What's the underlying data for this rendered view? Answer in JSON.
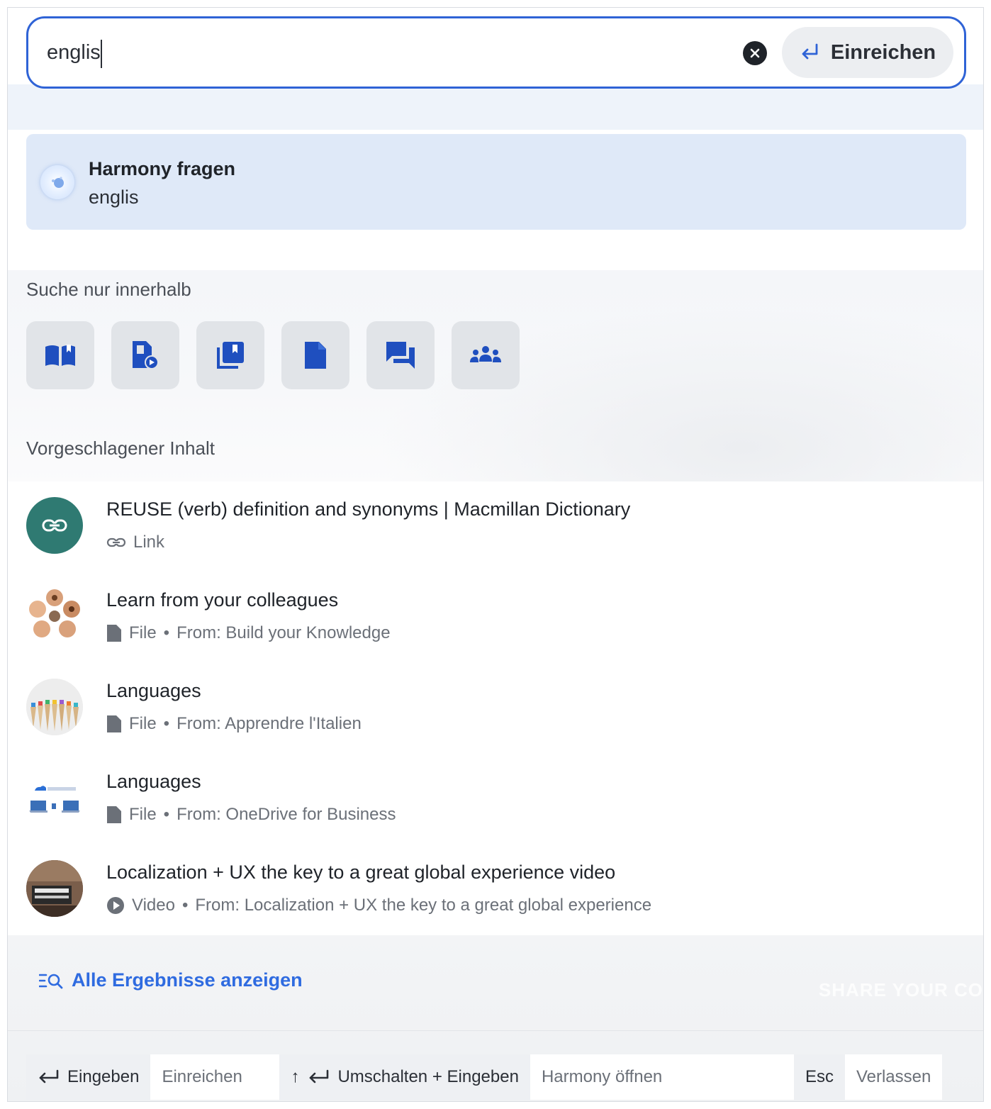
{
  "search": {
    "value": "englis",
    "clear_icon": "close-circle-icon",
    "submit_label": "Einreichen",
    "submit_icon": "enter-arrow-icon"
  },
  "harmony": {
    "title": "Harmony fragen",
    "query": "englis",
    "icon": "harmony-assistant-icon"
  },
  "scope": {
    "label": "Suche nur innerhalb",
    "buttons": [
      {
        "icon": "book-open-icon"
      },
      {
        "icon": "video-file-icon"
      },
      {
        "icon": "library-icon"
      },
      {
        "icon": "document-icon"
      },
      {
        "icon": "chat-icon"
      },
      {
        "icon": "community-icon"
      }
    ]
  },
  "suggested": {
    "label": "Vorgeschlagener Inhalt",
    "items": [
      {
        "title": "REUSE (verb) definition and synonyms | Macmillan Dictionary",
        "type": "Link",
        "source": "",
        "icon": "link-icon"
      },
      {
        "title": "Learn from your colleagues",
        "type": "File",
        "source": "From: Build your Knowledge",
        "icon": "file-icon"
      },
      {
        "title": "Languages",
        "type": "File",
        "source": "From: Apprendre l'Italien",
        "icon": "file-icon"
      },
      {
        "title": "Languages",
        "type": "File",
        "source": "From: OneDrive for Business",
        "icon": "file-icon"
      },
      {
        "title": "Localization + UX the key to a great global experience video",
        "type": "Video",
        "source": "From: Localization + UX the key to a great global experience",
        "icon": "play-icon"
      }
    ]
  },
  "all_results": {
    "label": "Alle Ergebnisse anzeigen",
    "icon": "search-list-icon"
  },
  "footer": {
    "enter_key": "Eingeben",
    "enter_desc": "Einreichen",
    "shift_up": "↑",
    "shift_key": "Umschalten + Eingeben",
    "shift_desc": "Harmony öffnen",
    "esc_key": "Esc",
    "esc_desc": "Verlassen"
  },
  "background": {
    "ghost_text": "SHARE YOUR CO"
  },
  "colors": {
    "accent": "#2f63d6",
    "link": "#2f6be0",
    "scope_icon": "#1f4fbf",
    "link_badge": "#2f7a72"
  }
}
